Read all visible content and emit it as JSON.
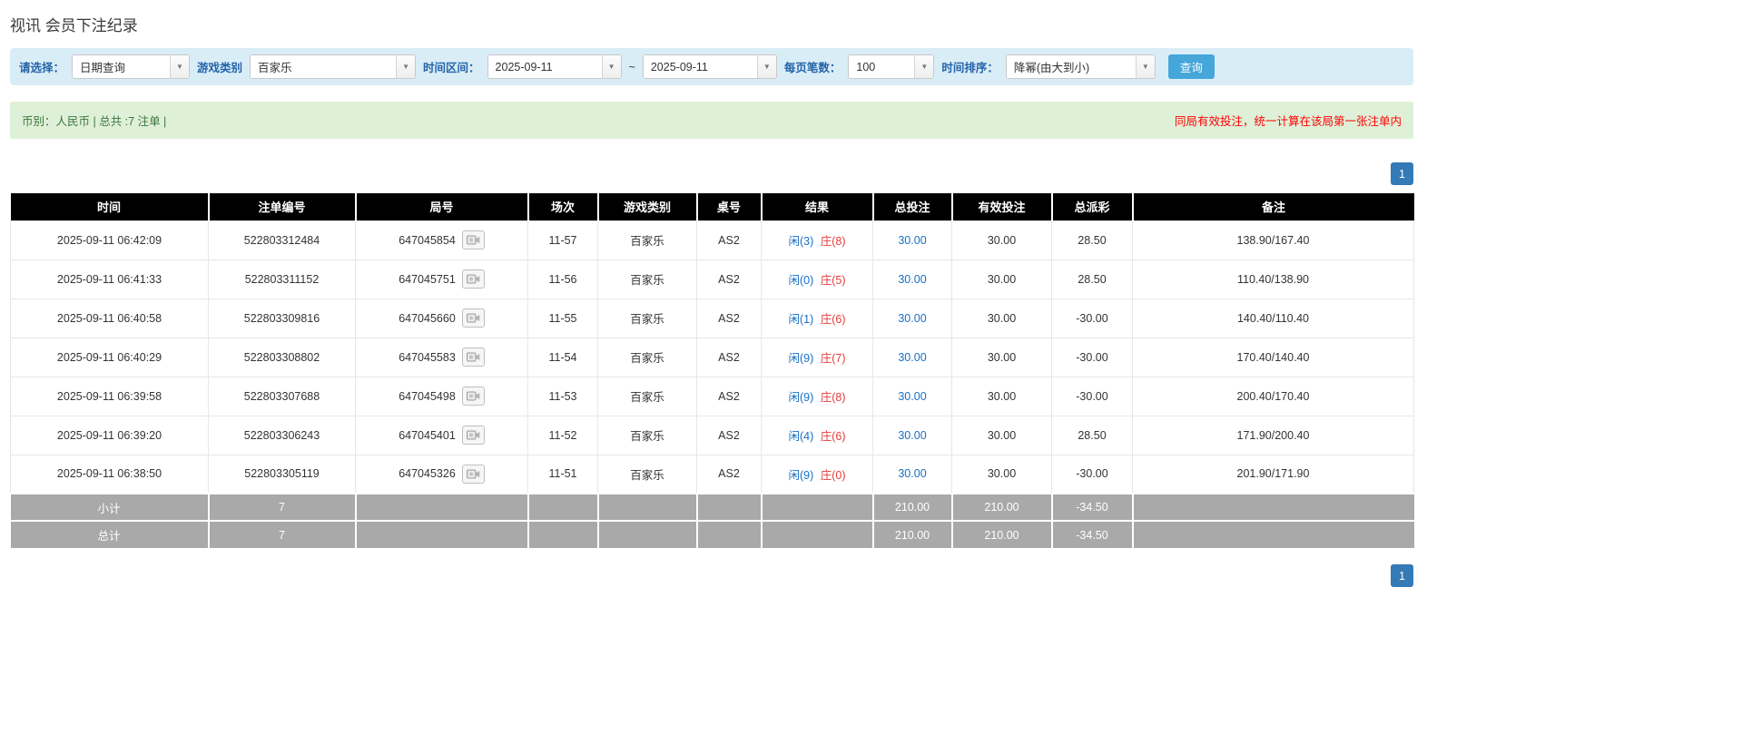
{
  "page": {
    "title": "视讯 会员下注纪录"
  },
  "filters": {
    "select_label": "请选择：",
    "select_value": "日期查询",
    "game_type_label": "游戏类别",
    "game_type_value": "百家乐",
    "range_label": "时间区间：",
    "date_from": "2025-09-11",
    "tilde": "~",
    "date_to": "2025-09-11",
    "page_size_label": "每页笔数：",
    "page_size_value": "100",
    "sort_label": "时间排序：",
    "sort_value": "降幂(由大到小)",
    "search_label": "查询"
  },
  "summary": {
    "info": "币别：人民币 | 总共 :7 注单 |",
    "note": "同局有效投注，统一计算在该局第一张注单内"
  },
  "pagination": {
    "current": "1"
  },
  "icons": {
    "combo_arrow": "▼",
    "replay": "round-replay-icon"
  },
  "table": {
    "headers": [
      "时间",
      "注单编号",
      "局号",
      "场次",
      "游戏类别",
      "桌号",
      "结果",
      "总投注",
      "有效投注",
      "总派彩",
      "备注"
    ],
    "rows": [
      {
        "time": "2025-09-11 06:42:09",
        "bet_id": "522803312484",
        "round_id": "647045854",
        "session": "11-57",
        "game": "百家乐",
        "table_no": "AS2",
        "player": "闲(3)",
        "banker": "庄(8)",
        "total_bet": "30.00",
        "valid_bet": "30.00",
        "payout": "28.50",
        "remark": "138.90/167.40"
      },
      {
        "time": "2025-09-11 06:41:33",
        "bet_id": "522803311152",
        "round_id": "647045751",
        "session": "11-56",
        "game": "百家乐",
        "table_no": "AS2",
        "player": "闲(0)",
        "banker": "庄(5)",
        "total_bet": "30.00",
        "valid_bet": "30.00",
        "payout": "28.50",
        "remark": "110.40/138.90"
      },
      {
        "time": "2025-09-11 06:40:58",
        "bet_id": "522803309816",
        "round_id": "647045660",
        "session": "11-55",
        "game": "百家乐",
        "table_no": "AS2",
        "player": "闲(1)",
        "banker": "庄(6)",
        "total_bet": "30.00",
        "valid_bet": "30.00",
        "payout": "-30.00",
        "remark": "140.40/110.40"
      },
      {
        "time": "2025-09-11 06:40:29",
        "bet_id": "522803308802",
        "round_id": "647045583",
        "session": "11-54",
        "game": "百家乐",
        "table_no": "AS2",
        "player": "闲(9)",
        "banker": "庄(7)",
        "total_bet": "30.00",
        "valid_bet": "30.00",
        "payout": "-30.00",
        "remark": "170.40/140.40"
      },
      {
        "time": "2025-09-11 06:39:58",
        "bet_id": "522803307688",
        "round_id": "647045498",
        "session": "11-53",
        "game": "百家乐",
        "table_no": "AS2",
        "player": "闲(9)",
        "banker": "庄(8)",
        "total_bet": "30.00",
        "valid_bet": "30.00",
        "payout": "-30.00",
        "remark": "200.40/170.40"
      },
      {
        "time": "2025-09-11 06:39:20",
        "bet_id": "522803306243",
        "round_id": "647045401",
        "session": "11-52",
        "game": "百家乐",
        "table_no": "AS2",
        "player": "闲(4)",
        "banker": "庄(6)",
        "total_bet": "30.00",
        "valid_bet": "30.00",
        "payout": "28.50",
        "remark": "171.90/200.40"
      },
      {
        "time": "2025-09-11 06:38:50",
        "bet_id": "522803305119",
        "round_id": "647045326",
        "session": "11-51",
        "game": "百家乐",
        "table_no": "AS2",
        "player": "闲(9)",
        "banker": "庄(0)",
        "total_bet": "30.00",
        "valid_bet": "30.00",
        "payout": "-30.00",
        "remark": "201.90/171.90"
      }
    ],
    "subtotal": {
      "label": "小计",
      "count": "7",
      "total_bet": "210.00",
      "valid_bet": "210.00",
      "payout": "-34.50"
    },
    "total": {
      "label": "总计",
      "count": "7",
      "total_bet": "210.00",
      "valid_bet": "210.00",
      "payout": "-34.50"
    }
  },
  "colors": {
    "accent": "#337ab7",
    "header_bg": "#000000",
    "footer_bg": "#a9a9a9",
    "filter_bg": "#d9edf7",
    "summary_bg": "#dff0d8",
    "summary_text": "#3c763d",
    "negative": "#ff0000",
    "banker_red": "#e43b3b",
    "player_blue": "#1a6fc4",
    "link_blue": "#1a6fc4",
    "button_bg": "#45a6d9",
    "label_blue": "#2464a8"
  }
}
